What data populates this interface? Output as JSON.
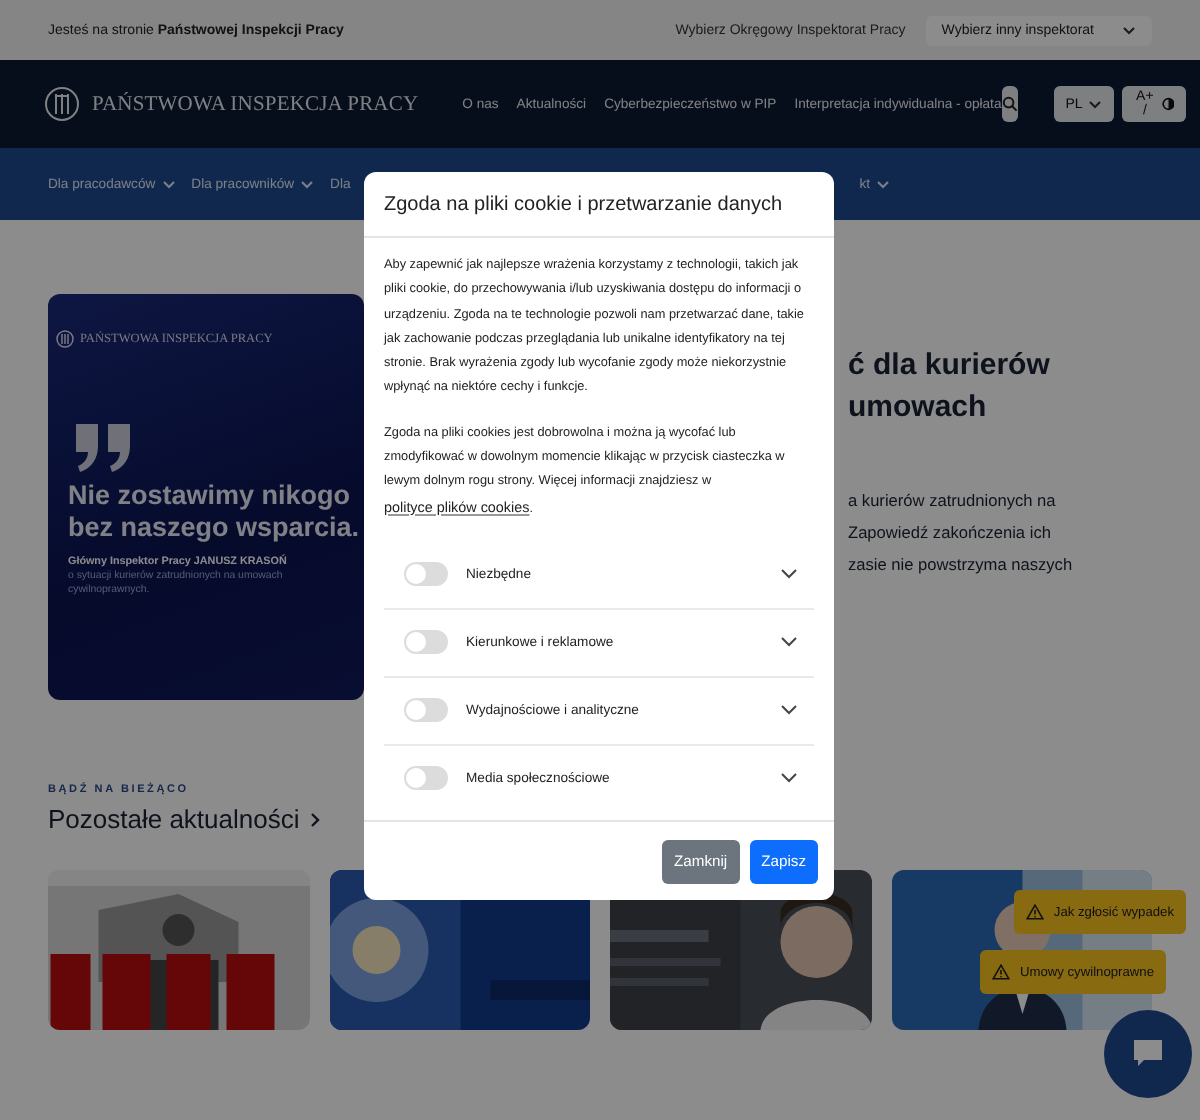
{
  "top_bar": {
    "location_text": "Jesteś na stronie **Państwowej Inspekcji Pracy**",
    "inspectorate_label": "Wybierz Okręgowy Inspektorat Pracy",
    "inspectorate_select": "Wybierz inny inspektorat"
  },
  "header": {
    "logo_text": "PAŃSTWOWA INSPEKCJA PRACY",
    "nav": [
      "O nas",
      "Aktualności",
      "Cyberbezpieczeństwo w PIP",
      "Interpretacja indywidualna - opłata"
    ],
    "language": "PL",
    "accessibility": "A+ /"
  },
  "subnav": [
    {
      "label": "Dla pracodawców",
      "caret": true
    },
    {
      "label": "Dla pracowników",
      "caret": true
    },
    {
      "label": "Dla",
      "caret": false
    },
    {
      "label": "kt",
      "caret": true
    }
  ],
  "hero": {
    "banner": {
      "logo_text": "PAŃSTWOWA INSPEKCJA PRACY",
      "quote": "Nie zostawimy nikogo bez naszego wsparcia.",
      "author": "Główny Inspektor Pracy JANUSZ KRASOŃ",
      "caption": "o sytuacji kurierów zatrudnionych na umowach cywilnoprawnych."
    },
    "article_title_lines": [
      "ć dla kurierów",
      "umowach"
    ],
    "article_text_lines": [
      "a kurierów zatrudnionych na",
      "Zapowiedź zakończenia ich",
      "zasie nie powstrzyma naszych"
    ]
  },
  "news": {
    "kicker": "BĄDŹ NA BIEŻĄCO",
    "title": "Pozostałe aktualności"
  },
  "floating_buttons": [
    {
      "label": "Jak zgłosić wypadek"
    },
    {
      "label": "Umowy cywilnoprawne"
    }
  ],
  "cookie_dialog": {
    "title": "Zgoda na pliki cookie i przetwarzanie danych",
    "paragraphs": [
      {
        "text": "Aby zapewnić jak najlepsze wrażenia korzystamy z technologii, takich jak pliki cookie, do przechowywania i/lub uzyskiwania dostępu do informacji o urządzeniu. Zgoda na te technologie pozwoli nam przetwarzać dane, takie jak zachowanie podczas przeglądania lub unikalne identyfikatory na tej stronie. Brak wyrażenia zgody lub wycofanie zgody może niekorzystnie wpłynąć na niektóre cechy i funkcje."
      },
      {
        "text": "Zgoda na pliki cookies jest dobrowolna i można ją wycofać lub zmodyfikować w dowolnym momencie klikając w przycisk ciasteczka w lewym dolnym rogu strony. Więcej informacji znajdziesz w ",
        "link": "polityce plików cookies",
        "after": "."
      }
    ],
    "categories": [
      {
        "label": "Niezbędne",
        "checked": false,
        "expanded": false
      },
      {
        "label": "Kierunkowe i reklamowe",
        "checked": false,
        "expanded": false
      },
      {
        "label": "Wydajnościowe i analityczne",
        "checked": false,
        "expanded": false
      },
      {
        "label": "Media społecznościowe",
        "checked": false,
        "expanded": false
      }
    ],
    "buttons": [
      {
        "label": "Zamknij",
        "kind": "secondary"
      },
      {
        "label": "Zapisz",
        "kind": "primary"
      }
    ]
  }
}
